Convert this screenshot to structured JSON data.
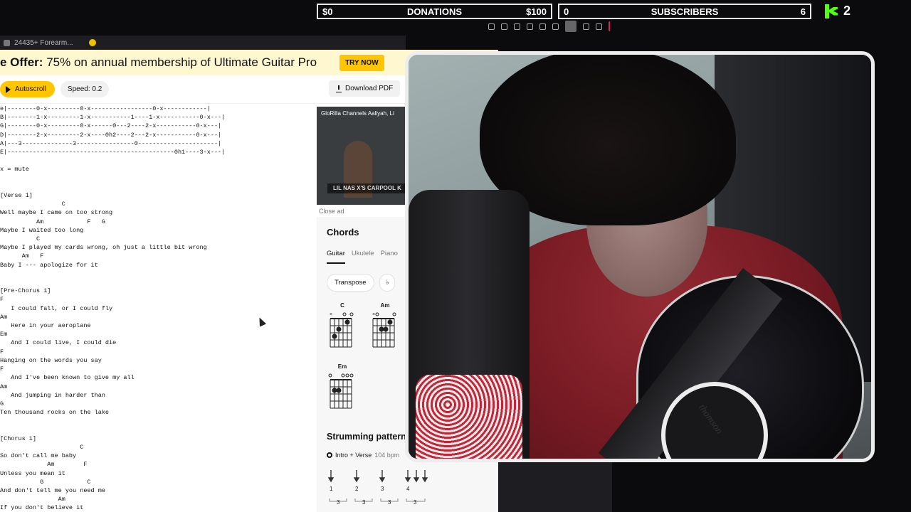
{
  "overlay": {
    "donations": {
      "left": "$0",
      "title": "DONATIONS",
      "right": "$100"
    },
    "subscribers": {
      "left": "0",
      "title": "SUBSCRIBERS",
      "right": "6"
    },
    "kick_count": "2"
  },
  "browser": {
    "tab_title": "24435+ Forearm..."
  },
  "promo": {
    "bold": "e Offer:",
    "text": " 75% on annual membership of Ultimate Guitar Pro",
    "cta": "TRY NOW"
  },
  "toolbar": {
    "autoscroll": "Autoscroll",
    "speed": "Speed: 0.2",
    "download": "Download PDF"
  },
  "tab_text": "e|--------0-x---------0-x-----------------0-x------------|\nB|--------1-x---------1-x-----------1----1-x-----------0-x---|\nG|--------0-x---------0-x------0---2----2-x-----------0-x---|\nD|--------2-x---------2-x----0h2----2---2-x-----------0-x---|\nA|---3--------------3----------------0----------------------|\nE|----------------------------------------------0h1----3-x---|\n\nx = mute\n\n\n[Verse 1]\n                 C\nWell maybe I came on too strong\n          Am            F   G\nMaybe I waited too long\n          C\nMaybe I played my cards wrong, oh just a little bit wrong\n      Am   F\nBaby I --- apologize for it\n\n\n[Pre-Chorus 1]\nF\n   I could fall, or I could fly\nAm\n   Here in your aeroplane\nEm\n   And I could live, I could die\nF\nHanging on the words you say\nF\n   And I've been known to give my all\nAm\n   And jumping in harder than\nG\nTen thousand rocks on the lake\n\n\n[Chorus 1]\n                      C\nSo don't call me baby\n             Am        F\nUnless you mean it\n           G            C\nAnd don't tell me you need me\n                Am\nIf you don't believe it",
  "ad": {
    "title": "GloRilla Channels Aaliyah, Li",
    "banner": "LIL NAS X'S CARPOOL K",
    "close": "Close ad"
  },
  "chords": {
    "title": "Chords",
    "instruments": [
      "Guitar",
      "Ukulele",
      "Piano"
    ],
    "transpose": "Transpose",
    "flat": "♭",
    "diagrams": [
      "C",
      "Am",
      "Em"
    ]
  },
  "strumming": {
    "title": "Strumming pattern",
    "section": "Intro + Verse",
    "bpm": "104 bpm",
    "beats": [
      "1",
      "2",
      "3",
      "4"
    ],
    "triplet": "3"
  },
  "webcam": {
    "guitar_brand": "thomson"
  }
}
